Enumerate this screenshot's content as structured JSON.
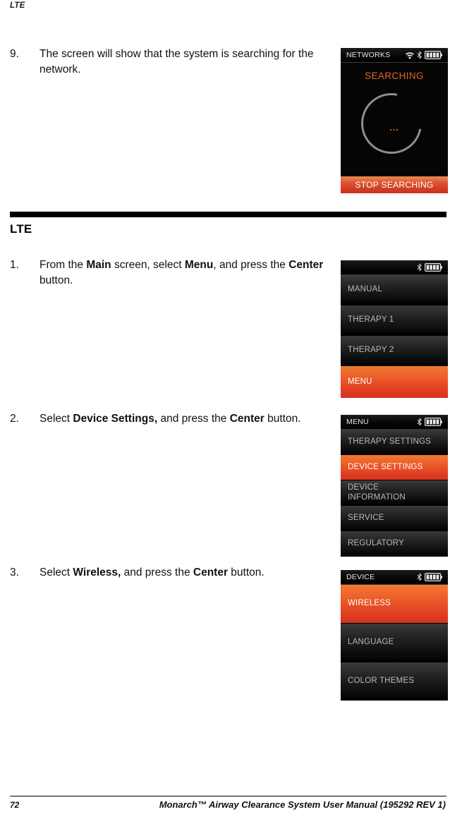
{
  "running_head": "LTE",
  "section": {
    "heading": "LTE",
    "rule_color": "#000000"
  },
  "accent_color": "#e2651f",
  "steps": [
    {
      "number": "9.",
      "segments": [
        {
          "text": "The screen will show that the system is searching for the network.",
          "bold": false
        }
      ]
    },
    {
      "number": "1.",
      "segments": [
        {
          "text": "From the ",
          "bold": false
        },
        {
          "text": "Main",
          "bold": true
        },
        {
          "text": " screen, select ",
          "bold": false
        },
        {
          "text": "Menu",
          "bold": true
        },
        {
          "text": ", and press the ",
          "bold": false
        },
        {
          "text": "Center",
          "bold": true
        },
        {
          "text": " button.",
          "bold": false
        }
      ]
    },
    {
      "number": "2.",
      "segments": [
        {
          "text": "Select ",
          "bold": false
        },
        {
          "text": "Device Settings,",
          "bold": true
        },
        {
          "text": " and press the ",
          "bold": false
        },
        {
          "text": "Center",
          "bold": true
        },
        {
          "text": " button.",
          "bold": false
        }
      ]
    },
    {
      "number": "3.",
      "segments": [
        {
          "text": "Select ",
          "bold": false
        },
        {
          "text": "Wireless,",
          "bold": true
        },
        {
          "text": " and press the ",
          "bold": false
        },
        {
          "text": "Center",
          "bold": true
        },
        {
          "text": " button.",
          "bold": false
        }
      ]
    }
  ],
  "devices": {
    "searching": {
      "status_title": "NETWORKS",
      "icons": [
        "wifi-icon",
        "bluetooth-icon",
        "battery-icon"
      ],
      "screen_title": "SEARCHING",
      "dots": "...",
      "action_label": "STOP SEARCHING"
    },
    "main_menu": {
      "status_title": "",
      "icons": [
        "bluetooth-icon",
        "battery-icon"
      ],
      "rows": [
        {
          "label": "MANUAL",
          "selected": false
        },
        {
          "label": "THERAPY 1",
          "selected": false
        },
        {
          "label": "THERAPY 2",
          "selected": false
        },
        {
          "label": "MENU",
          "selected": true
        }
      ]
    },
    "menu": {
      "status_title": "MENU",
      "icons": [
        "bluetooth-icon",
        "battery-icon"
      ],
      "rows": [
        {
          "label": "THERAPY SETTINGS",
          "selected": false
        },
        {
          "label": "DEVICE SETTINGS",
          "selected": true
        },
        {
          "label": "DEVICE INFORMATION",
          "selected": false
        },
        {
          "label": "SERVICE",
          "selected": false
        },
        {
          "label": "REGULATORY",
          "selected": false
        }
      ]
    },
    "device_settings": {
      "status_title": "DEVICE",
      "icons": [
        "bluetooth-icon",
        "battery-icon"
      ],
      "rows": [
        {
          "label": "WIRELESS",
          "selected": true
        },
        {
          "label": "LANGUAGE",
          "selected": false
        },
        {
          "label": "COLOR THEMES",
          "selected": false
        }
      ]
    }
  },
  "footer": {
    "page_number": "72",
    "manual_title": "Monarch™ Airway Clearance System User Manual (195292 REV 1)"
  }
}
